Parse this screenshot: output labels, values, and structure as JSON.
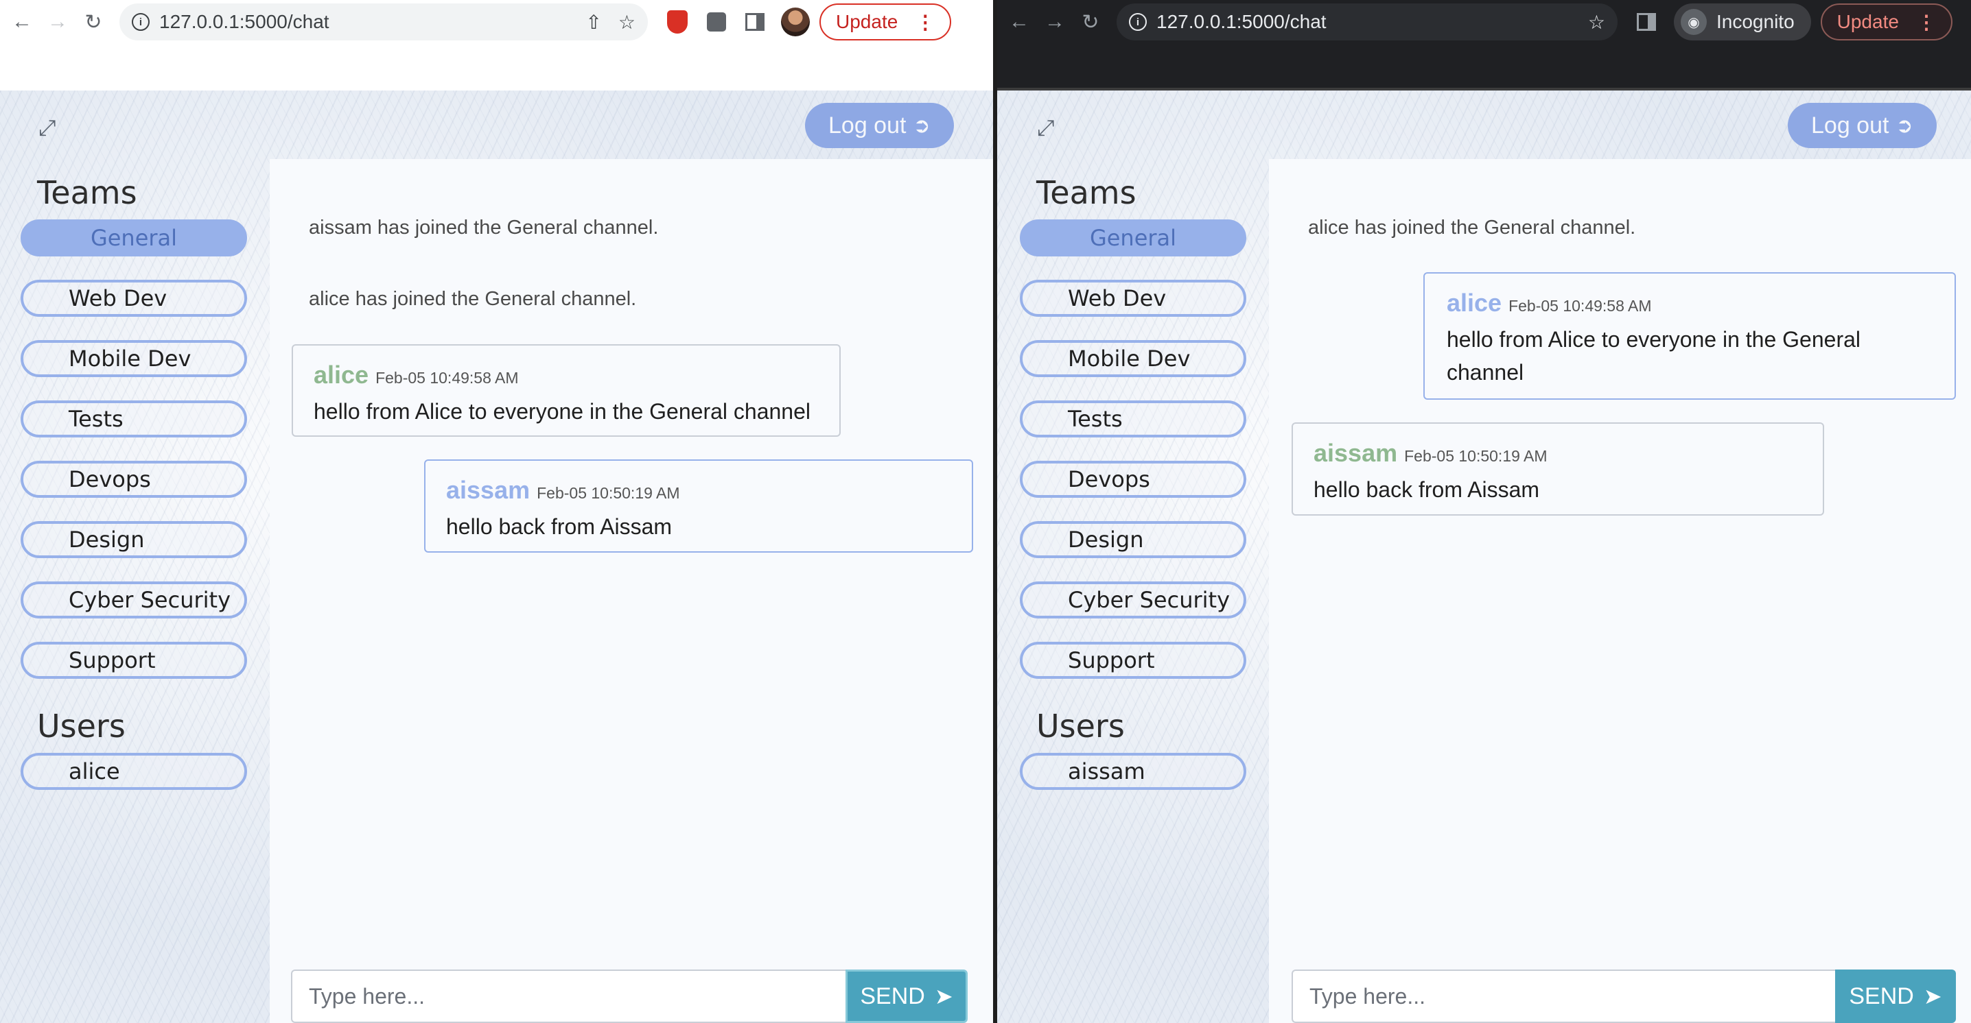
{
  "left_window": {
    "url": "127.0.0.1:5000/chat",
    "update_label": "Update",
    "logout_label": "Log out",
    "teams_title": "Teams",
    "channels": [
      "General",
      "Web Dev",
      "Mobile Dev",
      "Tests",
      "Devops",
      "Design",
      "Cyber Security",
      "Support"
    ],
    "active_channel": "General",
    "users_title": "Users",
    "users": [
      "alice"
    ],
    "system_messages": [
      "aissam has joined the General channel.",
      "alice has joined the General channel."
    ],
    "messages": [
      {
        "user": "alice",
        "time": "Feb-05 10:49:58 AM",
        "text": "hello from Alice to everyone in the General channel",
        "user_color": "#8fb890"
      },
      {
        "user": "aissam",
        "time": "Feb-05 10:50:19 AM",
        "text": "hello back from Aissam",
        "user_color": "#97b1ea"
      }
    ],
    "input_placeholder": "Type here...",
    "send_label": "SEND"
  },
  "right_window": {
    "url": "127.0.0.1:5000/chat",
    "incognito_label": "Incognito",
    "update_label": "Update",
    "logout_label": "Log out",
    "teams_title": "Teams",
    "channels": [
      "General",
      "Web Dev",
      "Mobile Dev",
      "Tests",
      "Devops",
      "Design",
      "Cyber Security",
      "Support"
    ],
    "active_channel": "General",
    "users_title": "Users",
    "users": [
      "aissam"
    ],
    "system_messages": [
      "alice has joined the General channel."
    ],
    "messages": [
      {
        "user": "alice",
        "time": "Feb-05 10:49:58 AM",
        "text_line1": "hello from Alice to everyone in the General",
        "text_line2": "channel",
        "user_color": "#97b1ea"
      },
      {
        "user": "aissam",
        "time": "Feb-05 10:50:19 AM",
        "text": "hello back from Aissam",
        "user_color": "#8fb890"
      }
    ],
    "input_placeholder": "Type here...",
    "send_label": "SEND"
  },
  "colors": {
    "accent": "#97b1ea",
    "send_button": "#4aa3bd",
    "alert_red": "#d93025"
  },
  "icons": [
    "back-icon",
    "forward-icon",
    "reload-icon",
    "info-icon",
    "share-icon",
    "star-icon",
    "extension-icon",
    "side-panel-icon",
    "expand-icon",
    "logout-icon",
    "paper-plane-icon",
    "incognito-icon",
    "menu-dots-icon"
  ]
}
